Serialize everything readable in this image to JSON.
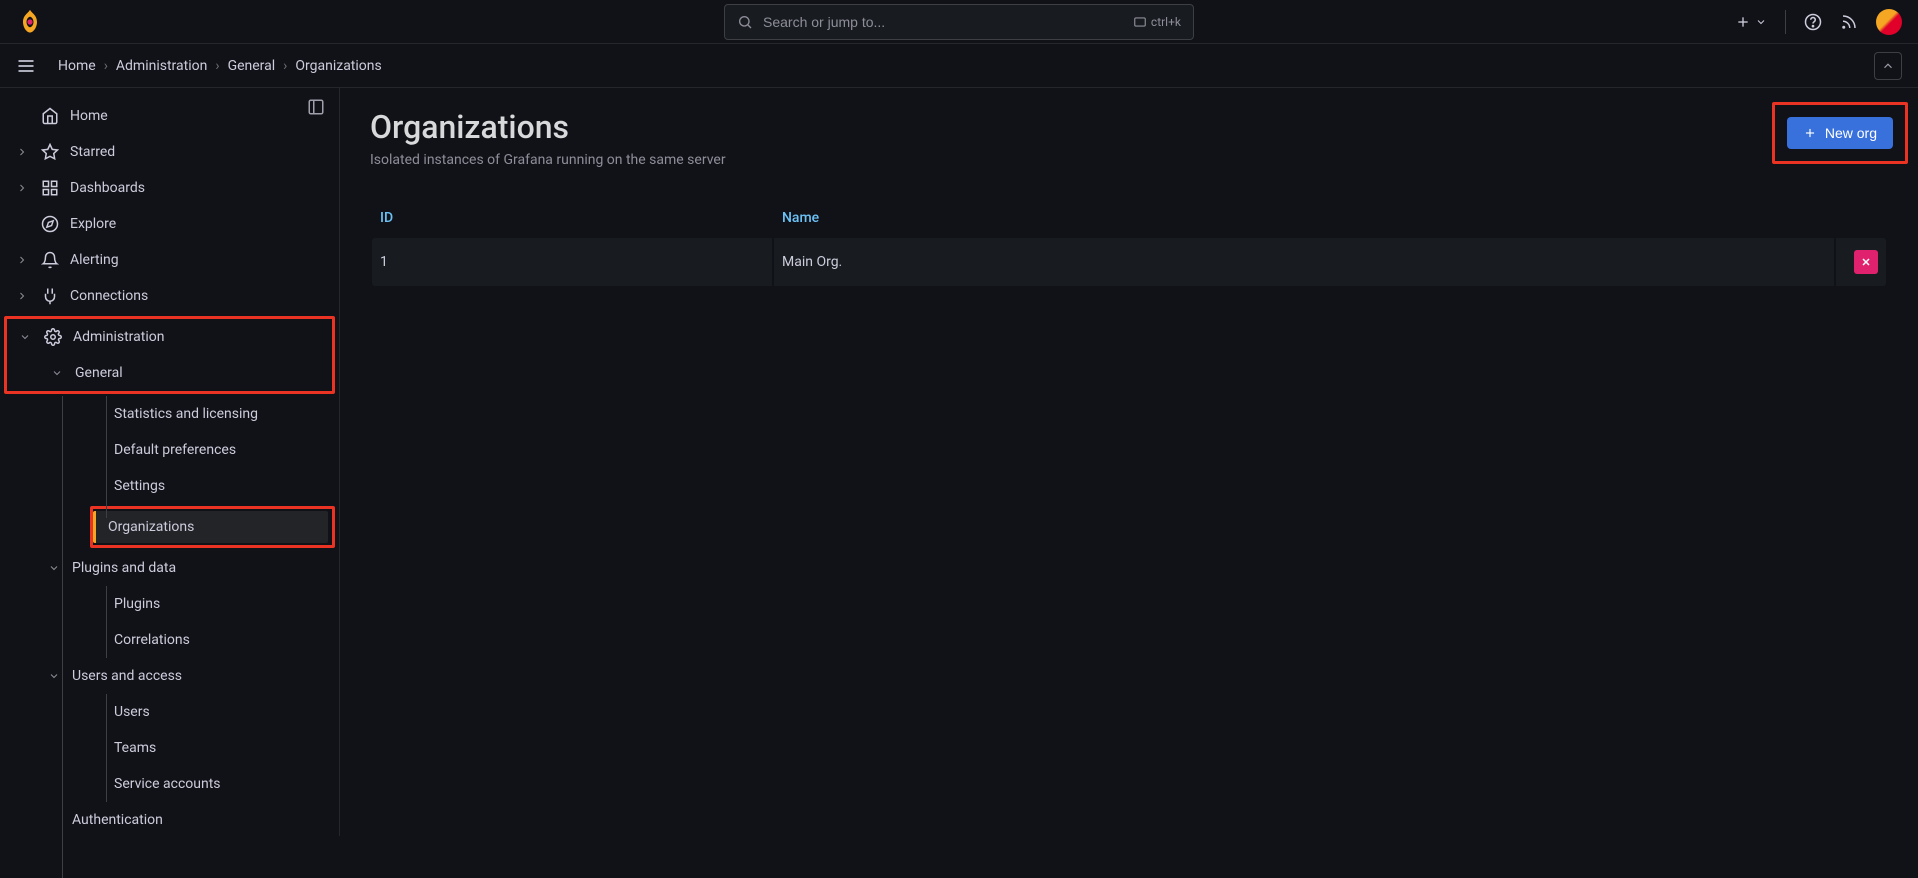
{
  "search": {
    "placeholder": "Search or jump to...",
    "shortcut": "ctrl+k"
  },
  "breadcrumb": {
    "home": "Home",
    "admin": "Administration",
    "general": "General",
    "orgs": "Organizations"
  },
  "sidebar": {
    "home": "Home",
    "starred": "Starred",
    "dashboards": "Dashboards",
    "explore": "Explore",
    "alerting": "Alerting",
    "connections": "Connections",
    "administration": "Administration",
    "general": "General",
    "stats": "Statistics and licensing",
    "defprefs": "Default preferences",
    "settings": "Settings",
    "orgs": "Organizations",
    "plugdata": "Plugins and data",
    "plugins": "Plugins",
    "correlations": "Correlations",
    "usersaccess": "Users and access",
    "users": "Users",
    "teams": "Teams",
    "svcaccts": "Service accounts",
    "auth": "Authentication"
  },
  "page": {
    "title": "Organizations",
    "subtitle": "Isolated instances of Grafana running on the same server",
    "new_org": "New org"
  },
  "table": {
    "col_id": "ID",
    "col_name": "Name",
    "rows": [
      {
        "id": "1",
        "name": "Main Org."
      }
    ]
  }
}
